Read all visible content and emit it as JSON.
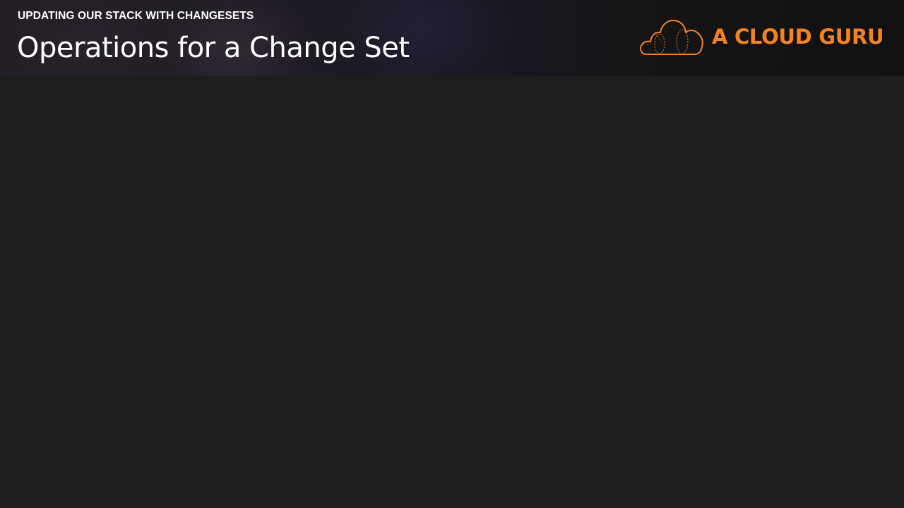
{
  "header": {
    "section_label": "UPDATING OUR STACK WITH CHANGESETS",
    "title": "Operations for a Change Set"
  },
  "logo": {
    "text": "A CLOUD GURU",
    "icon": "cloud-icon",
    "color": "#f58220"
  },
  "colors": {
    "background": "#1e1e1e",
    "text": "#ffffff",
    "accent": "#f58220"
  }
}
